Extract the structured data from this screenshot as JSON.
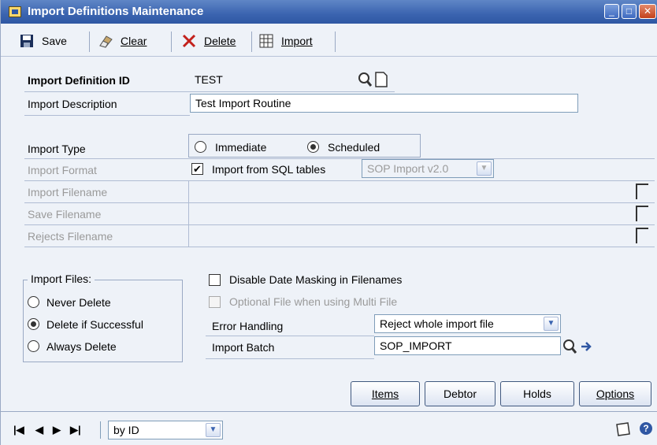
{
  "window": {
    "title": "Import Definitions Maintenance"
  },
  "toolbar": {
    "save": "Save",
    "clear": "Clear",
    "delete": "Delete",
    "import": "Import"
  },
  "form": {
    "id_label": "Import Definition ID",
    "id_value": "TEST",
    "desc_label": "Import Description",
    "desc_value": "Test Import Routine",
    "type_label": "Import Type",
    "type_immediate": "Immediate",
    "type_scheduled": "Scheduled",
    "type_selected": "Scheduled",
    "format_label": "Import Format",
    "from_sql_label": "Import from SQL tables",
    "from_sql_checked": true,
    "format_value": "SOP Import v2.0",
    "filename_label": "Import Filename",
    "save_filename_label": "Save Filename",
    "rejects_filename_label": "Rejects Filename"
  },
  "import_files": {
    "legend": "Import Files:",
    "options": [
      "Never Delete",
      "Delete if Successful",
      "Always Delete"
    ],
    "selected": "Delete if Successful"
  },
  "options": {
    "disable_masking": "Disable Date Masking in Filenames",
    "optional_file": "Optional File when using Multi File",
    "error_handling_label": "Error Handling",
    "error_handling_value": "Reject whole import file",
    "import_batch_label": "Import Batch",
    "import_batch_value": "SOP_IMPORT"
  },
  "buttons": {
    "items": "Items",
    "debtor": "Debtor",
    "holds": "Holds",
    "options": "Options"
  },
  "status": {
    "sort_value": "by ID"
  }
}
